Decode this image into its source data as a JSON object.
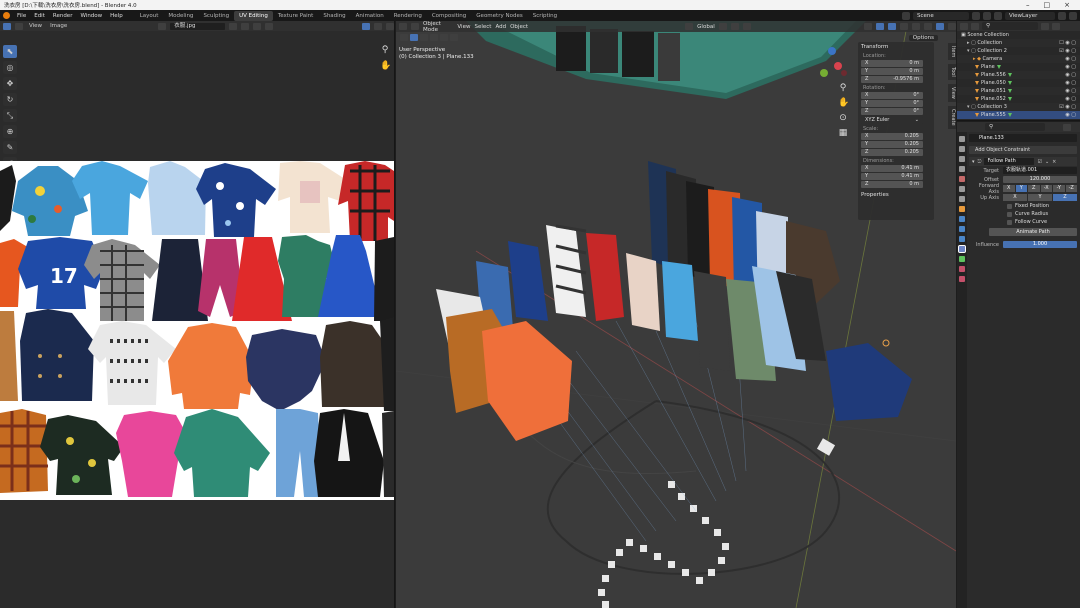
{
  "window": {
    "title": "洗衣房 [D:\\下载\\洗衣房\\洗衣房.blend] - Blender 4.0"
  },
  "menu": [
    "File",
    "Edit",
    "Render",
    "Window",
    "Help"
  ],
  "workspaces": [
    "Layout",
    "Modeling",
    "Sculpting",
    "UV Editing",
    "Texture Paint",
    "Shading",
    "Animation",
    "Rendering",
    "Compositing",
    "Geometry Nodes",
    "Scripting"
  ],
  "active_workspace": "UV Editing",
  "top_right": {
    "scene": "Scene",
    "view_layer": "ViewLayer"
  },
  "uv_editor": {
    "menu": [
      "View",
      "Image"
    ],
    "image_name": "衣服.jpg"
  },
  "viewport": {
    "mode": "Object Mode",
    "menu": [
      "View",
      "Select",
      "Add",
      "Object"
    ],
    "transform_orientation": "Global",
    "options_label": "Options",
    "info_line1": "User Perspective",
    "info_line2": "(0) Collection 3 | Plane.133",
    "side_tabs": [
      "Item",
      "Tool",
      "View",
      "Create"
    ]
  },
  "npanel": {
    "title": "Transform",
    "location_label": "Location:",
    "location": [
      [
        "X",
        "0 m"
      ],
      [
        "Y",
        "0 m"
      ],
      [
        "Z",
        "-0.9576 m"
      ]
    ],
    "rotation_label": "Rotation:",
    "rotation": [
      [
        "X",
        "0°"
      ],
      [
        "Y",
        "0°"
      ],
      [
        "Z",
        "0°"
      ]
    ],
    "rotation_mode": "XYZ Euler",
    "scale_label": "Scale:",
    "scale": [
      [
        "X",
        "0.205"
      ],
      [
        "Y",
        "0.205"
      ],
      [
        "Z",
        "0.205"
      ]
    ],
    "dimensions_label": "Dimensions:",
    "dimensions": [
      [
        "X",
        "0.41 m"
      ],
      [
        "Y",
        "0.41 m"
      ],
      [
        "Z",
        "0 m"
      ]
    ],
    "properties_label": "Properties"
  },
  "outliner": {
    "rows": [
      {
        "label": "Scene Collection",
        "kind": "root"
      },
      {
        "label": "Collection",
        "kind": "collection"
      },
      {
        "label": "Collection 2",
        "kind": "collection"
      },
      {
        "label": "Camera",
        "kind": "object"
      },
      {
        "label": "Plane",
        "kind": "object"
      },
      {
        "label": "Plane.556",
        "kind": "object"
      },
      {
        "label": "Plane.050",
        "kind": "object"
      },
      {
        "label": "Plane.051",
        "kind": "object"
      },
      {
        "label": "Plane.052",
        "kind": "object"
      },
      {
        "label": "Collection 3",
        "kind": "collection"
      },
      {
        "label": "Plane.555",
        "kind": "object"
      }
    ]
  },
  "properties": {
    "object_name": "Plane.133",
    "add_constraint": "Add Object Constraint",
    "constraint_name": "Follow Path",
    "target_label": "Target",
    "target_value": "衣服轨道.001",
    "offset_label": "Offset",
    "offset_value": "120.000",
    "forward_axis_label": "Forward Axis",
    "forward_axes": [
      "X",
      "Y",
      "Z",
      "-X",
      "-Y",
      "-Z"
    ],
    "forward_active": "Y",
    "up_axis_label": "Up Axis",
    "up_axes": [
      "X",
      "Y",
      "Z"
    ],
    "up_active": "Z",
    "options": [
      "Fixed Position",
      "Curve Radius",
      "Follow Curve"
    ],
    "animate_path": "Animate Path",
    "influence_label": "Influence",
    "influence_value": "1.000"
  },
  "colors": {
    "accent": "#4772b3",
    "blender_orange": "#e87d0d",
    "viewport_bg": "#3a3a3a",
    "panel_bg": "#2b2b2b"
  }
}
